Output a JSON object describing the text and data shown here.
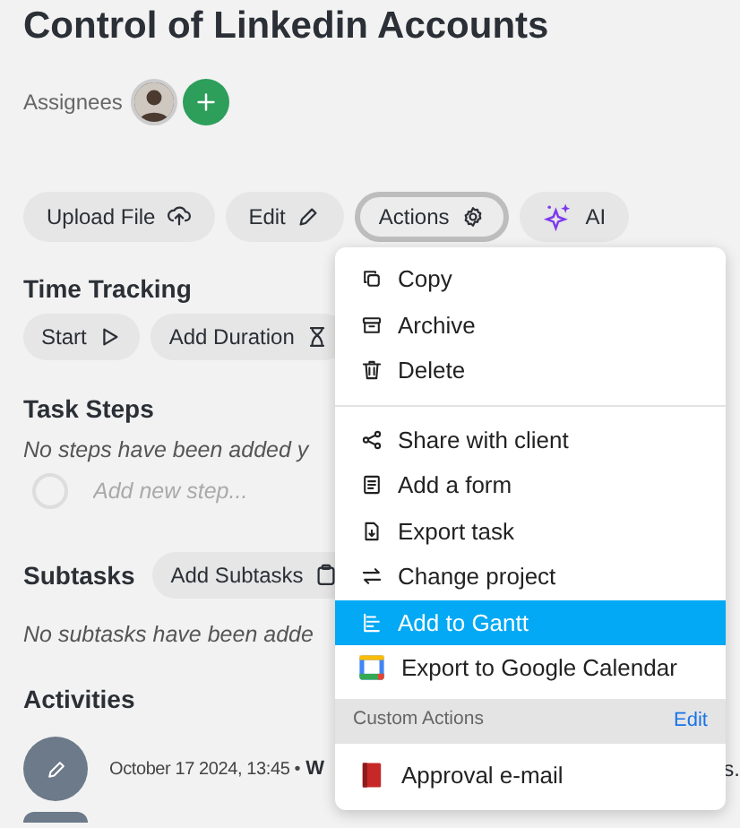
{
  "title": "Control of Linkedin Accounts",
  "assignees": {
    "label": "Assignees"
  },
  "toolbar": [
    {
      "label": "Upload File",
      "kind": "upload",
      "selected": false
    },
    {
      "label": "Edit",
      "kind": "pencil",
      "selected": false
    },
    {
      "label": "Actions",
      "kind": "gear",
      "selected": true
    },
    {
      "label": "AI",
      "kind": "sparkle",
      "selected": false
    }
  ],
  "time_tracking": {
    "heading": "Time Tracking",
    "buttons": [
      {
        "label": "Start",
        "kind": "play"
      },
      {
        "label": "Add Duration",
        "kind": "hourglass"
      }
    ]
  },
  "task_steps": {
    "heading": "Task Steps",
    "empty_note": "No steps have been added y",
    "new_step_placeholder": "Add new step...",
    "new_step_checked": false
  },
  "subtasks": {
    "heading": "Subtasks",
    "button": "Add Subtasks",
    "empty_note": "No subtasks have been adde"
  },
  "activities": {
    "heading": "Activities",
    "entries": [
      {
        "time": "October 17 2024, 13:45 •",
        "author": "W",
        "tail": "s."
      }
    ]
  },
  "menu": {
    "groups": [
      [
        {
          "label": "Copy",
          "kind": "copy",
          "selected": false
        },
        {
          "label": "Archive",
          "kind": "archive",
          "selected": false
        },
        {
          "label": "Delete",
          "kind": "trash",
          "selected": false
        }
      ],
      [
        {
          "label": "Share with client",
          "kind": "share",
          "selected": false
        },
        {
          "label": "Add a form",
          "kind": "form",
          "selected": false
        },
        {
          "label": "Export task",
          "kind": "file",
          "selected": false
        },
        {
          "label": "Change project",
          "kind": "swap",
          "selected": false
        },
        {
          "label": "Add to Gantt",
          "kind": "gantt",
          "selected": true
        },
        {
          "label": "Export to Google Calendar",
          "kind": "calendar",
          "selected": false
        }
      ]
    ],
    "custom_header": "Custom Actions",
    "custom_edit": "Edit",
    "custom_items": [
      {
        "label": "Approval e-mail",
        "kind": "book",
        "selected": false
      }
    ]
  }
}
